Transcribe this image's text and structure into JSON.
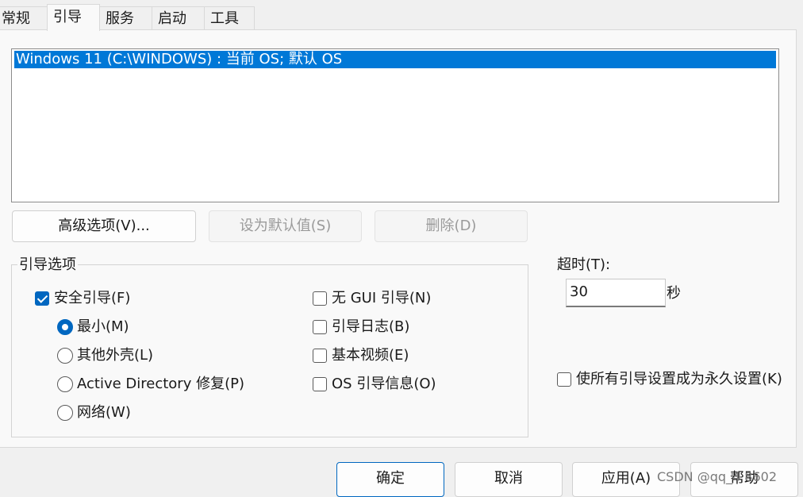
{
  "tabs": [
    {
      "label": "常规"
    },
    {
      "label": "引导"
    },
    {
      "label": "服务"
    },
    {
      "label": "启动"
    },
    {
      "label": "工具"
    }
  ],
  "os_list": {
    "items": [
      {
        "label": "Windows 11 (C:\\WINDOWS) : 当前 OS; 默认 OS",
        "selected": true
      }
    ]
  },
  "buttons": {
    "advanced": "高级选项(V)...",
    "set_default": "设为默认值(S)",
    "delete": "删除(D)"
  },
  "boot_options": {
    "title": "引导选项",
    "safe_boot": {
      "label": "安全引导(F)",
      "checked": true
    },
    "minimal": {
      "label": "最小(M)",
      "selected": true
    },
    "alternate_shell": {
      "label": "其他外壳(L)",
      "selected": false
    },
    "ad_repair": {
      "label": "Active Directory 修复(P)",
      "selected": false
    },
    "network": {
      "label": "网络(W)",
      "selected": false
    },
    "no_gui": {
      "label": "无 GUI 引导(N)",
      "checked": false
    },
    "boot_log": {
      "label": "引导日志(B)",
      "checked": false
    },
    "base_video": {
      "label": "基本视频(E)",
      "checked": false
    },
    "os_boot_info": {
      "label": "OS 引导信息(O)",
      "checked": false
    }
  },
  "timeout": {
    "label": "超时(T):",
    "value": "30",
    "unit": "秒"
  },
  "permanent": {
    "label": "使所有引导设置成为永久设置(K)",
    "checked": false
  },
  "footer": {
    "ok": "确定",
    "cancel": "取消",
    "apply": "应用(A)",
    "help": "帮助"
  },
  "watermark": "CSDN @qq_4    8602",
  "colors": {
    "accent": "#0067c0",
    "selection": "#0078d7"
  }
}
